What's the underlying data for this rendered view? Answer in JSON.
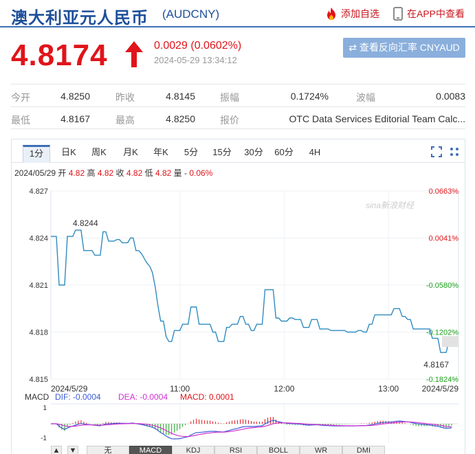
{
  "header": {
    "title": "澳大利亚元人民币",
    "code": "(AUDCNY)",
    "add_watchlist": "添加自选",
    "view_in_app": "在APP中查看"
  },
  "quote": {
    "price": "4.8174",
    "change": "0.0029 (0.0602%)",
    "timestamp": "2024-05-29 13:34:12",
    "reverse_button": "⇄ 查看反向汇率 CNYAUD"
  },
  "stats": {
    "row1": [
      {
        "label": "今开",
        "value": "4.8250"
      },
      {
        "label": "昨收",
        "value": "4.8145"
      },
      {
        "label": "振幅",
        "value": "0.1724%"
      },
      {
        "label": "波幅",
        "value": "0.0083"
      }
    ],
    "row2": [
      {
        "label": "最低",
        "value": "4.8167"
      },
      {
        "label": "最高",
        "value": "4.8250"
      },
      {
        "label": "报价",
        "value": "OTC Data Services Editorial Team Calc..."
      }
    ]
  },
  "tabs": [
    "1分",
    "日K",
    "周K",
    "月K",
    "年K",
    "5分",
    "15分",
    "30分",
    "60分",
    "4H"
  ],
  "active_tab": "1分",
  "info_line": {
    "date": "2024/05/29",
    "open_label": "开",
    "open": "4.82",
    "high_label": "高",
    "high": "4.82",
    "close_label": "收",
    "close": "4.82",
    "low_label": "低",
    "low": "4.82",
    "vol_label": "量 -",
    "pct": "0.06%"
  },
  "watermark": "sina新浪财经",
  "macd": {
    "label": "MACD",
    "dif": "DIF: -0.0004",
    "dea": "DEA: -0.0004",
    "macd": "MACD: 0.0001",
    "axis_top": "1",
    "axis_bottom": "-1"
  },
  "bottom_tabs": [
    "▲",
    "▼",
    "无",
    "MACD",
    "KDJ",
    "RSI",
    "BOLL",
    "WR",
    "DMI"
  ],
  "bottom_active": "MACD",
  "colors": {
    "up": "#e0141a",
    "down": "#1aa01a",
    "line": "#2f8bc0",
    "brand": "#1d4f9a",
    "dif": "#3b5bd6",
    "dea": "#d030d0"
  },
  "chart_data": {
    "type": "line",
    "title": "",
    "xlabel": "",
    "ylabel": "",
    "ylim": [
      4.815,
      4.827
    ],
    "y_ticks": [
      "4.827",
      "4.824",
      "4.821",
      "4.818",
      "4.815"
    ],
    "right_ticks": [
      "0.0663%",
      "0.0041%",
      "-0.0580%",
      "-0.1202%",
      "-0.1824%"
    ],
    "x_ticks": [
      "2024/5/29",
      "11:00",
      "12:00",
      "13:00",
      "2024/5/29"
    ],
    "annotations": [
      {
        "text": "4.8244"
      },
      {
        "text": "4.8167"
      }
    ],
    "series": [
      {
        "values": [
          4.8241,
          4.8241,
          4.8241,
          4.821,
          4.821,
          4.821,
          4.8241,
          4.8241,
          4.8241,
          4.8245,
          4.8245,
          4.8245,
          4.8232,
          4.8232,
          4.8232,
          4.8232,
          4.8229,
          4.8229,
          4.8229,
          4.8244,
          4.8244,
          4.8238,
          4.8238,
          4.8238,
          4.8239,
          4.8239,
          4.8237,
          4.8237,
          4.8237,
          4.824,
          4.824,
          4.8232,
          4.8232,
          4.823,
          4.8227,
          4.8224,
          4.8222,
          4.8218,
          4.8209,
          4.8197,
          4.8187,
          4.8187,
          4.8177,
          4.8174,
          4.8174,
          4.8181,
          4.8181,
          4.8181,
          4.8185,
          4.8185,
          4.8185,
          4.8196,
          4.8196,
          4.8196,
          4.8185,
          4.8185,
          4.8185,
          4.8185,
          4.8185,
          4.818,
          4.818,
          4.8174,
          4.8174,
          4.8174,
          4.8183,
          4.8183,
          4.8185,
          4.8185,
          4.8185,
          4.819,
          4.819,
          4.8185,
          4.8185,
          4.8181,
          4.8181,
          4.8185,
          4.8185,
          4.8185,
          4.8207,
          4.8207,
          4.8207,
          4.8207,
          4.8189,
          4.8189,
          4.8187,
          4.8187,
          4.8187,
          4.8189,
          4.8189,
          4.8188,
          4.8188,
          4.8188,
          4.8183,
          4.8183,
          4.8183,
          4.8188,
          4.8188,
          4.8188,
          4.8182,
          4.8182,
          4.8182,
          4.8182,
          4.8181,
          4.8181,
          4.8181,
          4.8181,
          4.8181,
          4.8181,
          4.818,
          4.818,
          4.818,
          4.818,
          4.8181,
          4.8181,
          4.818,
          4.818,
          4.8185,
          4.8185,
          4.8191,
          4.8191,
          4.8191,
          4.8191,
          4.8191,
          4.8191,
          4.8191,
          4.8195,
          4.8195,
          4.8195,
          4.819,
          4.819,
          4.8188,
          4.8188,
          4.8182,
          4.8182,
          4.8182,
          4.8182,
          4.8182,
          4.8182,
          4.8182,
          4.8176,
          4.8176,
          4.8176,
          4.8167,
          4.8167,
          4.8167,
          4.8174,
          4.8174
        ]
      }
    ]
  }
}
